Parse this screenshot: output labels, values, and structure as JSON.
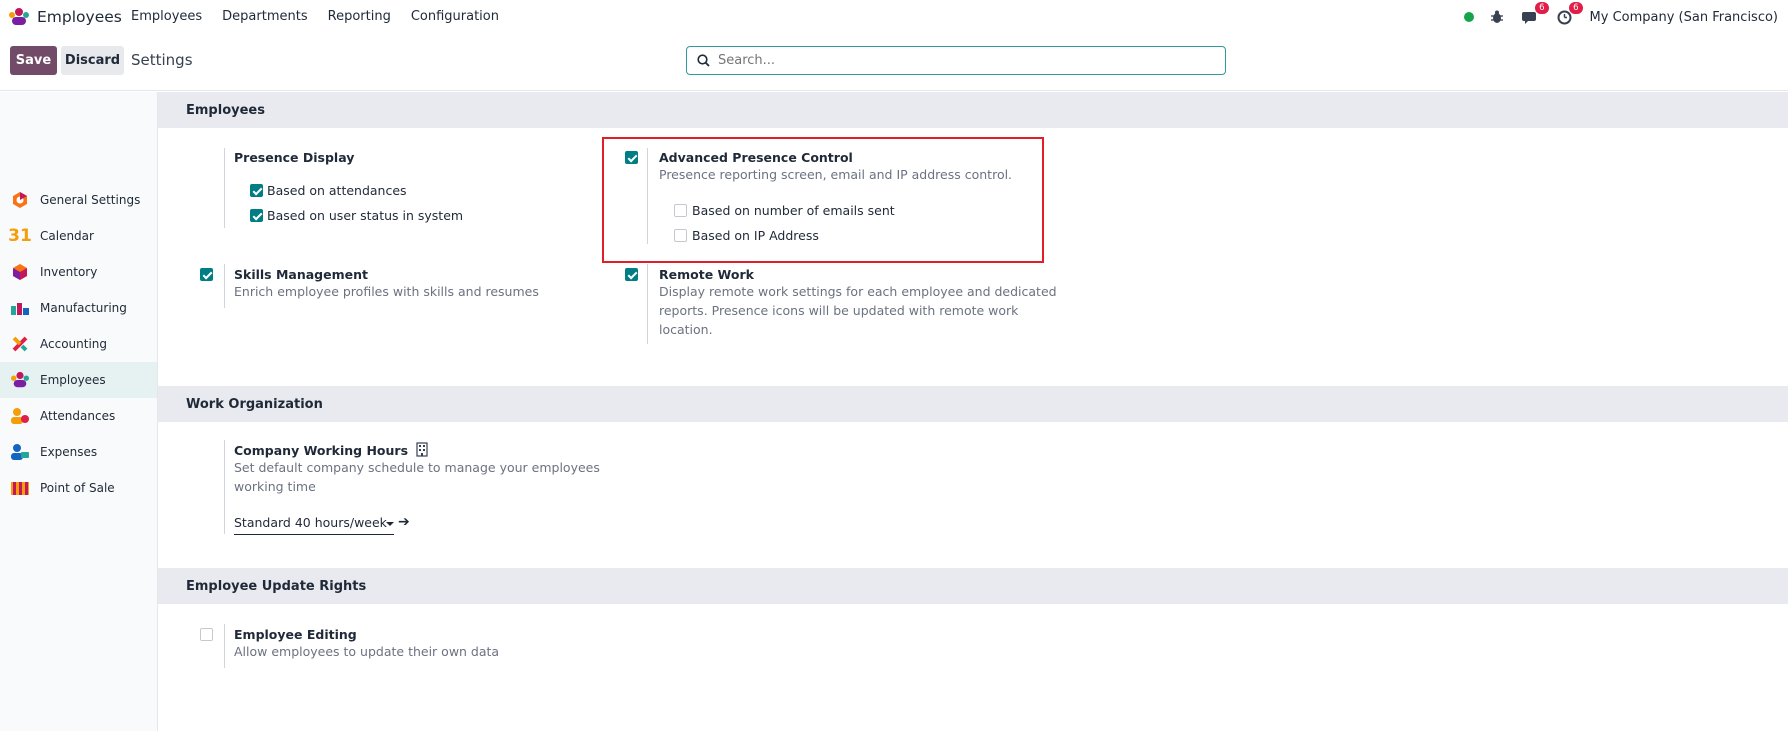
{
  "navbar": {
    "app_name": "Employees",
    "menu": [
      "Employees",
      "Departments",
      "Reporting",
      "Configuration"
    ],
    "messages_badge": "6",
    "activities_badge": "6",
    "company": "My Company (San Francisco)"
  },
  "control": {
    "save_label": "Save",
    "discard_label": "Discard",
    "title": "Settings",
    "search_placeholder": "Search..."
  },
  "sidebar": {
    "items": [
      {
        "label": "General Settings",
        "icon": "odoo-settings-icon"
      },
      {
        "label": "Calendar",
        "icon": "calendar-icon"
      },
      {
        "label": "Inventory",
        "icon": "inventory-icon"
      },
      {
        "label": "Manufacturing",
        "icon": "manufacturing-icon"
      },
      {
        "label": "Accounting",
        "icon": "accounting-icon"
      },
      {
        "label": "Employees",
        "icon": "employees-icon"
      },
      {
        "label": "Attendances",
        "icon": "attendances-icon"
      },
      {
        "label": "Expenses",
        "icon": "expenses-icon"
      },
      {
        "label": "Point of Sale",
        "icon": "point-of-sale-icon"
      }
    ],
    "active": "Employees",
    "calendar_number": "31"
  },
  "sections": {
    "employees": {
      "header": "Employees",
      "presence_display": {
        "title": "Presence Display",
        "options": [
          {
            "label": "Based on attendances",
            "checked": true
          },
          {
            "label": "Based on user status in system",
            "checked": true
          }
        ]
      },
      "advanced_presence": {
        "title": "Advanced Presence Control",
        "desc": "Presence reporting screen, email and IP address control.",
        "checked": true,
        "options": [
          {
            "label": "Based on number of emails sent",
            "checked": false
          },
          {
            "label": "Based on IP Address",
            "checked": false
          }
        ]
      },
      "skills": {
        "title": "Skills Management",
        "desc": "Enrich employee profiles with skills and resumes",
        "checked": true
      },
      "remote_work": {
        "title": "Remote Work",
        "desc_lines": [
          "Display remote work settings for each employee and dedicated",
          "reports. Presence icons will be updated with remote work",
          "location."
        ],
        "checked": true
      }
    },
    "work_org": {
      "header": "Work Organization",
      "working_hours": {
        "title": "Company Working Hours",
        "desc_lines": [
          "Set default company schedule to manage your employees",
          "working time"
        ],
        "value": "Standard 40 hours/week"
      }
    },
    "update_rights": {
      "header": "Employee Update Rights",
      "editing": {
        "title": "Employee Editing",
        "desc": "Allow employees to update their own data",
        "checked": false
      }
    }
  },
  "colors": {
    "brand": "#714b67",
    "teal": "#017e84",
    "highlight": "#e11d28"
  }
}
